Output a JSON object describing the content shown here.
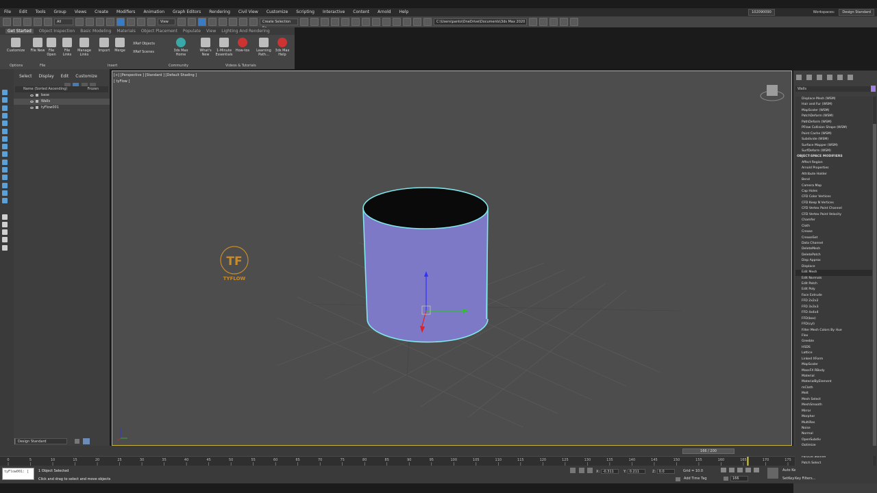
{
  "menu": [
    "File",
    "Edit",
    "Tools",
    "Group",
    "Views",
    "Create",
    "Modifiers",
    "Animation",
    "Graph Editors",
    "Rendering",
    "Civil View",
    "Customize",
    "Scripting",
    "Interactive",
    "Content",
    "Arnold",
    "Help"
  ],
  "user": "102090090",
  "workspaces_label": "Workspaces:",
  "workspace": "Design Standard",
  "toolbar": {
    "filter": "All",
    "view": "View",
    "selection_set": "Create Selection Se",
    "path": "C:\\Users\\panto\\OneDrive\\Documents\\3ds Max 2020"
  },
  "ribbon_tabs": [
    "Get Started",
    "Object Inspection",
    "Basic Modeling",
    "Materials",
    "Object Placement",
    "Populate",
    "View",
    "Lighting And Rendering"
  ],
  "ribbon_buttons": [
    {
      "label": "Customize"
    },
    {
      "label": "File New"
    },
    {
      "label": "File Open"
    },
    {
      "label": "File Links"
    },
    {
      "label": "Manage Links"
    },
    {
      "label": "Import"
    },
    {
      "label": "Merge"
    },
    {
      "label": "XRef Objects"
    },
    {
      "label": "XRef Scenes"
    },
    {
      "label": "3ds Max Home"
    },
    {
      "label": "What's New"
    },
    {
      "label": "1-Minute Essentials"
    },
    {
      "label": "How-tos"
    },
    {
      "label": "Learning Path..."
    },
    {
      "label": "3ds Max Help"
    }
  ],
  "ribbon_groups": [
    "Options",
    "File",
    "Insert",
    "Community",
    "Videos & Tutorials"
  ],
  "scene_explorer": {
    "tabs": [
      "Select",
      "Display",
      "Edit",
      "Customize"
    ],
    "header": "Name (Sorted Ascending)",
    "frozen": "Frozen",
    "rows": [
      {
        "name": "base"
      },
      {
        "name": "Walls"
      },
      {
        "name": "tyFlow001"
      }
    ]
  },
  "viewport": {
    "label": "[+] [Perspective ] [Standard ] [Default Shading ]",
    "sublabel": "[ tyFlow ]",
    "logo": "TYFLOW"
  },
  "command_panel": {
    "object_name": "Walls",
    "modifiers": [
      {
        "t": "Displace Mesh (WSM)"
      },
      {
        "t": "Hair and Fur (WSM)"
      },
      {
        "t": "MapScaler (WSM)"
      },
      {
        "t": "PatchDeform (WSM)"
      },
      {
        "t": "PathDeform (WSM)"
      },
      {
        "t": "PFlow Collision Shape (WSM)"
      },
      {
        "t": "Point Cache (WSM)"
      },
      {
        "t": "Subdivide (WSM)"
      },
      {
        "t": "Surface Mapper (WSM)"
      },
      {
        "t": "SurfDeform (WSM)"
      },
      {
        "t": "OBJECT-SPACE MODIFIERS",
        "h": true
      },
      {
        "t": "Affect Region"
      },
      {
        "t": "Arnold Properties"
      },
      {
        "t": "Attribute Holder"
      },
      {
        "t": "Bend"
      },
      {
        "t": "Camera Map"
      },
      {
        "t": "Cap Holes"
      },
      {
        "t": "CFD Color Vertices"
      },
      {
        "t": "CFD Keep N Vertices"
      },
      {
        "t": "CFD Vertex Paint Channel"
      },
      {
        "t": "CFD Vertex Paint Velocity"
      },
      {
        "t": "Chamfer"
      },
      {
        "t": "Cloth"
      },
      {
        "t": "Crease"
      },
      {
        "t": "CreaseSet"
      },
      {
        "t": "Data Channel"
      },
      {
        "t": "DeleteMesh"
      },
      {
        "t": "DeletePatch"
      },
      {
        "t": "Disp Approx"
      },
      {
        "t": "Displace"
      },
      {
        "t": "Edit Mesh",
        "hl": true
      },
      {
        "t": "Edit Normals"
      },
      {
        "t": "Edit Patch"
      },
      {
        "t": "Edit Poly"
      },
      {
        "t": "Face Extrude"
      },
      {
        "t": "FFD 2x2x2"
      },
      {
        "t": "FFD 3x3x3"
      },
      {
        "t": "FFD 4x4x4"
      },
      {
        "t": "FFD(box)"
      },
      {
        "t": "FFD(cyl)"
      },
      {
        "t": "Filter Mesh Colors By Hue"
      },
      {
        "t": "Flex"
      },
      {
        "t": "Greeble"
      },
      {
        "t": "HSDS"
      },
      {
        "t": "Lattice"
      },
      {
        "t": "Linked XForm"
      },
      {
        "t": "MapScaler"
      },
      {
        "t": "MassFX RBody"
      },
      {
        "t": "Material"
      },
      {
        "t": "MaterialByElement"
      },
      {
        "t": "mCloth"
      },
      {
        "t": "Melt"
      },
      {
        "t": "Mesh Select"
      },
      {
        "t": "MeshSmooth"
      },
      {
        "t": "Mirror"
      },
      {
        "t": "Morpher"
      },
      {
        "t": "MultiRes"
      },
      {
        "t": "Noise"
      },
      {
        "t": "Normal"
      },
      {
        "t": "OpenSubdiv"
      },
      {
        "t": "Optimize"
      },
      {
        "t": "Particle Face Creator"
      },
      {
        "t": "Particle Skinner"
      },
      {
        "t": "Patch Select"
      }
    ]
  },
  "time_slider": "166 / 200",
  "ticks": [
    "0",
    "5",
    "10",
    "15",
    "20",
    "25",
    "30",
    "35",
    "40",
    "45",
    "50",
    "55",
    "60",
    "65",
    "70",
    "75",
    "80",
    "85",
    "90",
    "95",
    "100",
    "105",
    "110",
    "115",
    "120",
    "125",
    "130",
    "135",
    "140",
    "145",
    "150",
    "155",
    "160",
    "165",
    "170",
    "175"
  ],
  "design_standard": "Design Standard",
  "status": {
    "maxscript": "tyFlow001: [",
    "selected": "1 Object Selected",
    "prompt": "Click and drag to select and move objects",
    "x_label": "X:",
    "x": "-0.311",
    "y_label": "Y:",
    "y": "0.211",
    "z_label": "Z:",
    "z": "0.0",
    "grid": "Grid = 10.0",
    "add_time_tag": "Add Time Tag",
    "frame": "166",
    "auto_key": "Auto Ke",
    "set_key": "SetKey",
    "key_filters": "Key Filters..."
  }
}
